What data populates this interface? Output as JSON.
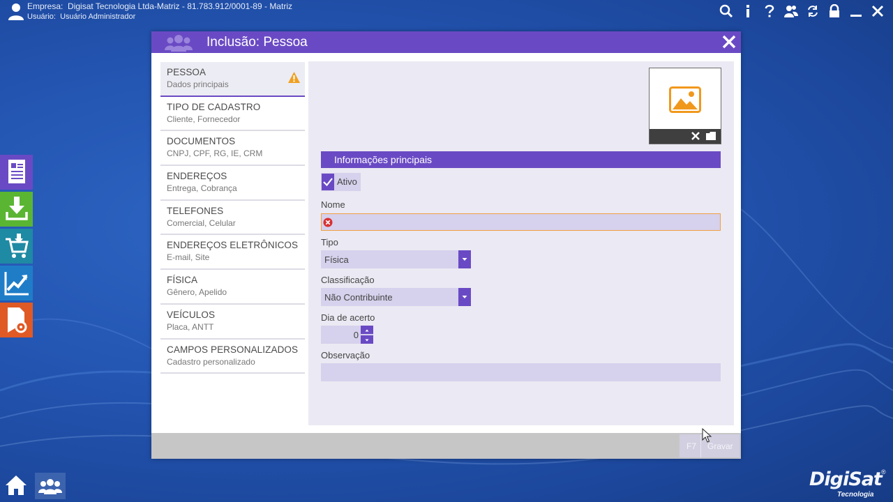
{
  "topbar": {
    "company_label": "Empresa:",
    "company_value": "Digisat Tecnologia Ltda-Matriz - 81.783.912/0001-89 - Matriz",
    "user_label": "Usuário:",
    "user_value": "Usuário Administrador",
    "icons": [
      "search-icon",
      "info-icon",
      "help-icon",
      "users-icon",
      "sync-icon",
      "lock-icon",
      "minimize-icon",
      "close-icon"
    ]
  },
  "dock": {
    "items": [
      {
        "icon": "document-icon",
        "color": "#6a4ac4"
      },
      {
        "icon": "download-icon",
        "color": "#5ab533"
      },
      {
        "icon": "shopping-cart-icon",
        "color": "#1f8aa3"
      },
      {
        "icon": "chart-icon",
        "color": "#1f7dc8"
      },
      {
        "icon": "report-settings-icon",
        "color": "#e05a25"
      }
    ]
  },
  "dialog": {
    "title": "Inclusão: Pessoa",
    "nav": [
      {
        "title": "PESSOA",
        "subtitle": "Dados principais",
        "active": true
      },
      {
        "title": "TIPO DE CADASTRO",
        "subtitle": "Cliente, Fornecedor"
      },
      {
        "title": "DOCUMENTOS",
        "subtitle": "CNPJ, CPF, RG, IE, CRM"
      },
      {
        "title": "ENDEREÇOS",
        "subtitle": "Entrega, Cobrança"
      },
      {
        "title": "TELEFONES",
        "subtitle": "Comercial, Celular"
      },
      {
        "title": "ENDEREÇOS ELETRÔNICOS",
        "subtitle": "E-mail, Site"
      },
      {
        "title": "FÍSICA",
        "subtitle": "Gênero, Apelido"
      },
      {
        "title": "VEÍCULOS",
        "subtitle": "Placa, ANTT"
      },
      {
        "title": "CAMPOS PERSONALIZADOS",
        "subtitle": "Cadastro personalizado"
      }
    ],
    "section_title": "Informações principais",
    "ativo_label": "Ativo",
    "nome_label": "Nome",
    "nome_value": "",
    "tipo_label": "Tipo",
    "tipo_value": "Física",
    "classificacao_label": "Classificação",
    "classificacao_value": "Não Contribuinte",
    "dia_acerto_label": "Dia de acerto",
    "dia_acerto_value": "0",
    "observacao_label": "Observação",
    "observacao_value": "",
    "footer": {
      "shortcut": "F7",
      "save_label": "Gravar"
    }
  },
  "brand": {
    "name": "DigiSat",
    "tagline": "Tecnologia",
    "reg": "®"
  },
  "colors": {
    "accent": "#6a4ac4",
    "warning": "#f0a020",
    "error": "#d93030",
    "field": "#d6d1ec"
  }
}
